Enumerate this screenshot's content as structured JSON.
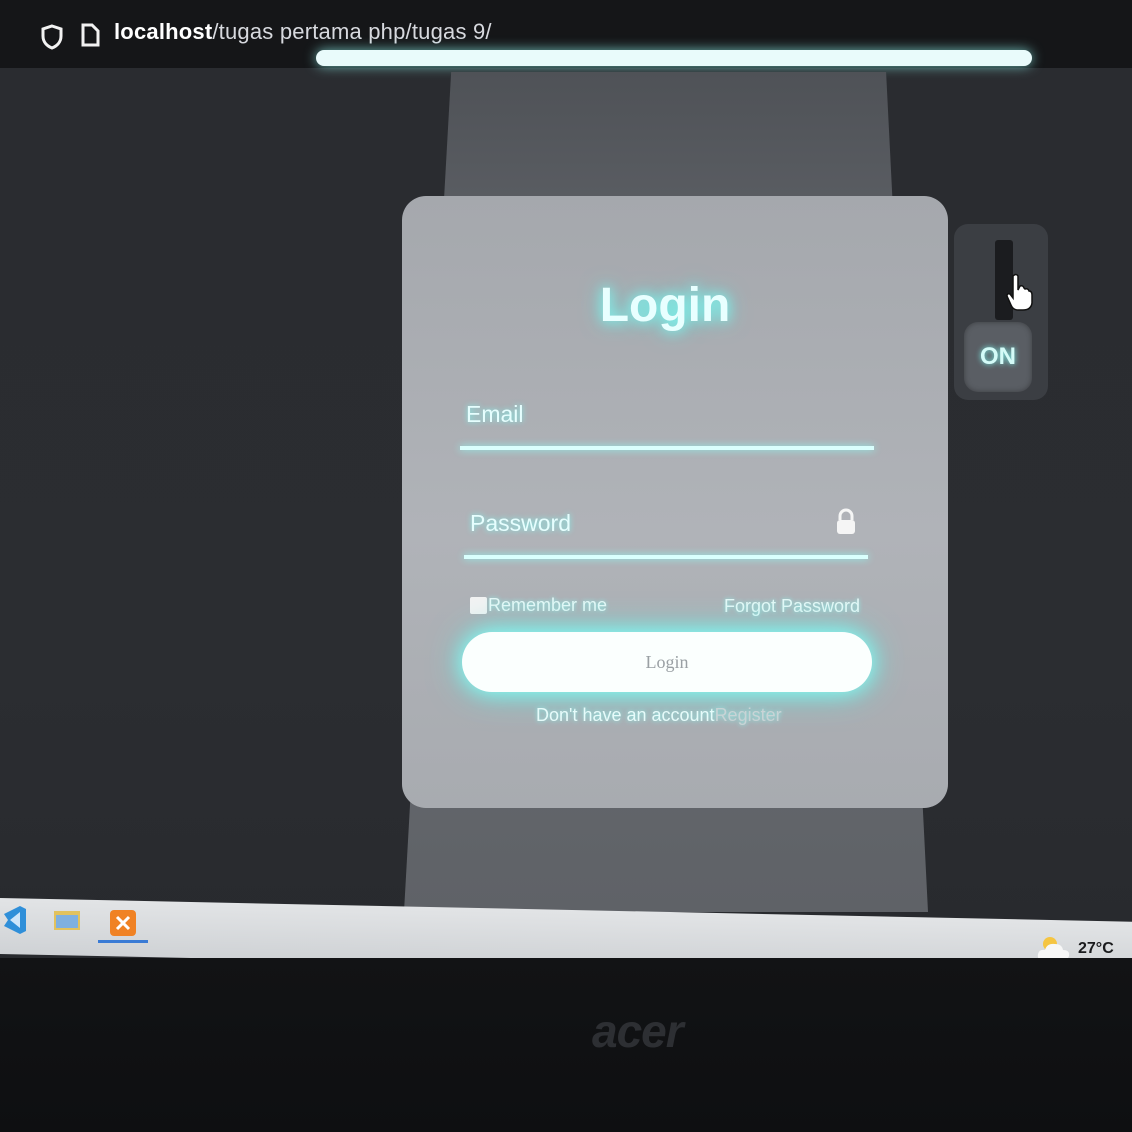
{
  "browser": {
    "url_host": "localhost",
    "url_path": "/tugas pertama php/tugas 9/"
  },
  "login_card": {
    "title": "Login",
    "email_label": "Email",
    "password_label": "Password",
    "remember_label": "Remember me",
    "forgot_label": "Forgot Password",
    "login_button": "Login",
    "register_prompt": "Don't have an account",
    "register_link": "Register"
  },
  "toggle": {
    "state_label": "ON"
  },
  "taskbar": {
    "temperature": "27°C"
  },
  "bezel": {
    "brand": "acer"
  },
  "colors": {
    "accent_glow": "#7ffcf5",
    "card": "#a8abb0",
    "background": "#2a2c30"
  }
}
